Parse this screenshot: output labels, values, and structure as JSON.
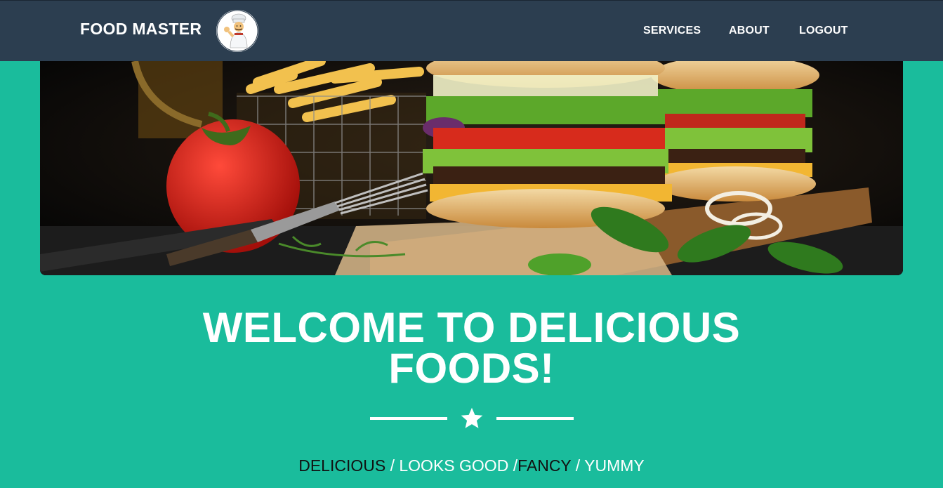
{
  "navbar": {
    "brand": "FOOD MASTER",
    "logo_icon": "chef-mascot-icon",
    "links": [
      "SERVICES",
      "ABOUT",
      "LOGOUT"
    ]
  },
  "hero": {
    "image": "burger-and-fries-photo",
    "heading_line1": "WELCOME TO DELICIOUS",
    "heading_line2": "FOODS!",
    "divider_icon": "star-icon",
    "tagline": {
      "part1": "DELICIOUS",
      "sep1": " / ",
      "part2": "LOOKS GOOD",
      "sep2": " /",
      "part3": "FANCY",
      "sep3": " / ",
      "part4": "YUMMY"
    }
  },
  "colors": {
    "navbar": "#2c3e50",
    "background": "#1abc9c",
    "text": "#ffffff"
  }
}
